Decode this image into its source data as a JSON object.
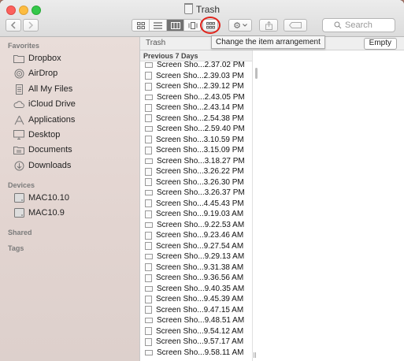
{
  "window": {
    "title": "Trash"
  },
  "toolbar": {
    "back_icon": "chevron-left-icon",
    "forward_icon": "chevron-right-icon",
    "view_modes": [
      "icon-view",
      "list-view",
      "column-view",
      "cover-flow-view"
    ],
    "active_view": "column-view",
    "arrange_icon": "grid-arrangement-icon",
    "action_icon": "gear-icon",
    "share_icon": "share-icon",
    "tag_icon": "tag-icon",
    "search_placeholder": "Search",
    "tooltip": "Change the item arrangement"
  },
  "sidebar": {
    "favorites_header": "Favorites",
    "favorites": [
      {
        "label": "Dropbox",
        "icon": "folder-icon"
      },
      {
        "label": "AirDrop",
        "icon": "airdrop-icon"
      },
      {
        "label": "All My Files",
        "icon": "all-files-icon"
      },
      {
        "label": "iCloud Drive",
        "icon": "cloud-icon"
      },
      {
        "label": "Applications",
        "icon": "applications-icon"
      },
      {
        "label": "Desktop",
        "icon": "desktop-icon"
      },
      {
        "label": "Documents",
        "icon": "documents-icon"
      },
      {
        "label": "Downloads",
        "icon": "downloads-icon"
      }
    ],
    "devices_header": "Devices",
    "devices": [
      {
        "label": "MAC10.10",
        "icon": "disk-icon"
      },
      {
        "label": "MAC10.9",
        "icon": "disk-icon"
      }
    ],
    "shared_header": "Shared",
    "tags_header": "Tags"
  },
  "pathbar": {
    "label": "Trash",
    "empty_button": "Empty"
  },
  "column": {
    "header": "Previous 7 Days",
    "files": [
      "Screen Sho...2.37.02 PM",
      "Screen Sho...2.39.03 PM",
      "Screen Sho...2.39.12 PM",
      "Screen Sho...2.43.05 PM",
      "Screen Sho...2.43.14 PM",
      "Screen Sho...2.54.38 PM",
      "Screen Sho...2.59.40 PM",
      "Screen Sho...3.10.59 PM",
      "Screen Sho...3.15.09 PM",
      "Screen Sho...3.18.27 PM",
      "Screen Sho...3.26.22 PM",
      "Screen Sho...3.26.30 PM",
      "Screen Sho...3.26.37 PM",
      "Screen Sho...4.45.43 PM",
      "Screen Sho...9.19.03 AM",
      "Screen Sho...9.22.53 AM",
      "Screen Sho...9.23.46 AM",
      "Screen Sho...9.27.54 AM",
      "Screen Sho...9.29.13 AM",
      "Screen Sho...9.31.38 AM",
      "Screen Sho...9.36.56 AM",
      "Screen Sho...9.40.35 AM",
      "Screen Sho...9.45.39 AM",
      "Screen Sho...9.47.15 AM",
      "Screen Sho...9.48.51 AM",
      "Screen Sho...9.54.12 AM",
      "Screen Sho...9.57.17 AM",
      "Screen Sho...9.58.11 AM"
    ]
  }
}
